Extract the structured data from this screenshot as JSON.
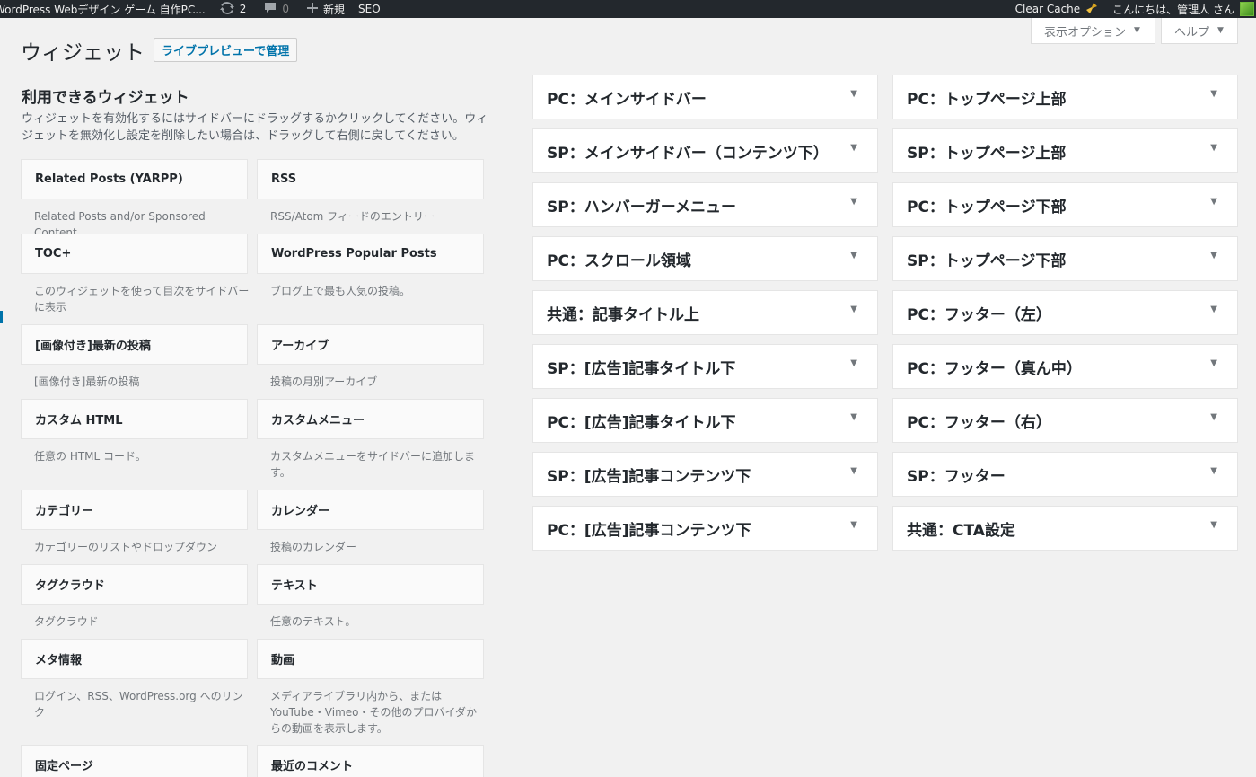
{
  "adminbar": {
    "site_name": "WordPress Webデザイン ゲーム 自作PC...",
    "updates_count": "2",
    "comments_count": "0",
    "new_label": "新規",
    "seo_label": "SEO",
    "clear_cache_label": "Clear Cache",
    "howdy": "こんにちは、管理人 さん"
  },
  "screen_meta": {
    "options_label": "表示オプション",
    "help_label": "ヘルプ",
    "arrow": "▼"
  },
  "page": {
    "title": "ウィジェット",
    "manage_live": "ライブプレビューで管理"
  },
  "available": {
    "title": "利用できるウィジェット",
    "description": "ウィジェットを有効化するにはサイドバーにドラッグするかクリックしてください。ウィジェットを無効化し設定を削除したい場合は、ドラッグして右側に戻してください。"
  },
  "widgets": [
    {
      "title": "Related Posts (YARPP)",
      "desc": "Related Posts and/or Sponsored Content"
    },
    {
      "title": "RSS",
      "desc": "RSS/Atom フィードのエントリー"
    },
    {
      "title": "TOC+",
      "desc": "このウィジェットを使って目次をサイドバーに表示"
    },
    {
      "title": "WordPress Popular Posts",
      "desc": "ブログ上で最も人気の投稿。"
    },
    {
      "title": "[画像付き]最新の投稿",
      "desc": "[画像付き]最新の投稿"
    },
    {
      "title": "アーカイブ",
      "desc": "投稿の月別アーカイブ"
    },
    {
      "title": "カスタム HTML",
      "desc": "任意の HTML コード。"
    },
    {
      "title": "カスタムメニュー",
      "desc": "カスタムメニューをサイドバーに追加します。"
    },
    {
      "title": "カテゴリー",
      "desc": "カテゴリーのリストやドロップダウン"
    },
    {
      "title": "カレンダー",
      "desc": "投稿のカレンダー"
    },
    {
      "title": "タグクラウド",
      "desc": "タグクラウド"
    },
    {
      "title": "テキスト",
      "desc": "任意のテキスト。"
    },
    {
      "title": "メタ情報",
      "desc": "ログイン、RSS、WordPress.org へのリンク"
    },
    {
      "title": "動画",
      "desc": "メディアライブラリ内から、または YouTube・Vimeo・その他のプロバイダからの動画を表示します。"
    },
    {
      "title": "固定ページ",
      "desc": ""
    },
    {
      "title": "最近のコメント",
      "desc": ""
    }
  ],
  "sidebars_left": [
    "PC：メインサイドバー",
    "SP：メインサイドバー（コンテンツ下）",
    "SP：ハンバーガーメニュー",
    "PC：スクロール領域",
    "共通：記事タイトル上",
    "SP：[広告]記事タイトル下",
    "PC：[広告]記事タイトル下",
    "SP：[広告]記事コンテンツ下",
    "PC：[広告]記事コンテンツ下"
  ],
  "sidebars_right": [
    "PC：トップページ上部",
    "SP：トップページ上部",
    "PC：トップページ下部",
    "SP：トップページ下部",
    "PC：フッター（左）",
    "PC：フッター（真ん中）",
    "PC：フッター（右）",
    "SP：フッター",
    "共通：CTA設定"
  ],
  "toggle_arrow": "▼",
  "colors": {
    "adminbar_bg": "#23282d",
    "link": "#0073aa",
    "page_bg": "#f1f1f1"
  }
}
